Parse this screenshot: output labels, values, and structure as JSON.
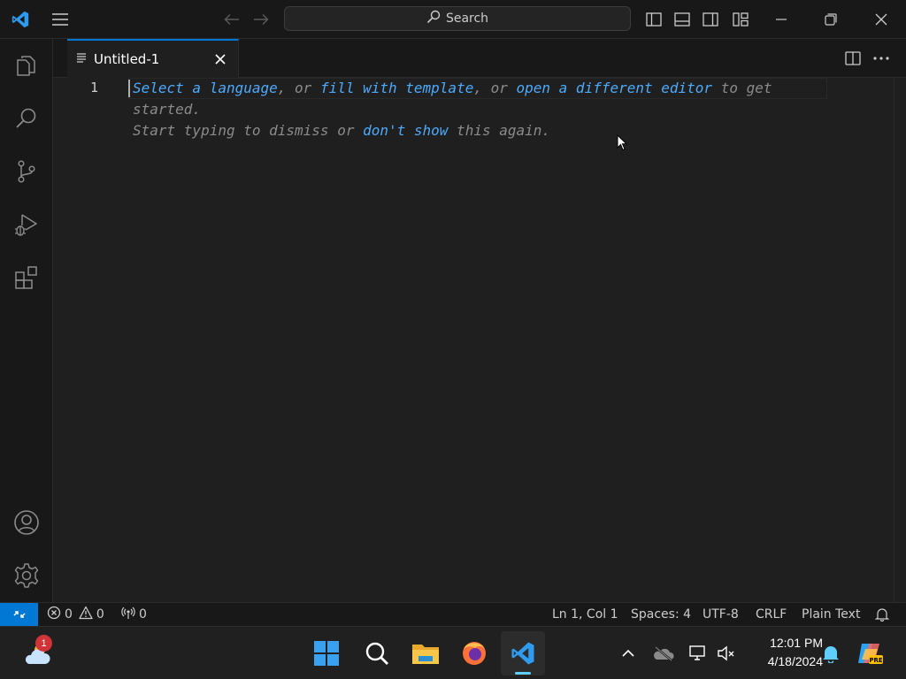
{
  "titlebar": {
    "search_label": "Search",
    "icons": [
      "vscode-logo-icon",
      "menu-icon",
      "back-arrow-icon",
      "forward-arrow-icon",
      "toggle-primary-sidebar-icon",
      "toggle-panel-icon",
      "toggle-secondary-sidebar-icon",
      "customize-layout-icon",
      "minimize-icon",
      "restore-icon",
      "close-icon"
    ]
  },
  "activitybar": {
    "items": [
      "explorer-icon",
      "search-icon",
      "source-control-icon",
      "run-debug-icon",
      "extensions-icon"
    ],
    "bottom": [
      "accounts-icon",
      "settings-gear-icon"
    ]
  },
  "tabs": [
    {
      "label": "Untitled-1",
      "active": true
    }
  ],
  "editor": {
    "line_number": "1",
    "hint": {
      "p1": "Select a language",
      "p2": ", or ",
      "p3": "fill with template",
      "p4": ", or ",
      "p5": "open a different editor",
      "p6": " to get started.",
      "p7": "Start typing to dismiss or ",
      "p8": "don't show",
      "p9": " this again."
    }
  },
  "statusbar": {
    "errors": "0",
    "warnings": "0",
    "ports": "0",
    "position": "Ln 1, Col 1",
    "spaces": "Spaces: 4",
    "encoding": "UTF-8",
    "eol": "CRLF",
    "language": "Plain Text"
  },
  "taskbar": {
    "weather_badge": "1",
    "time": "12:01 PM",
    "date": "4/18/2024",
    "apps": [
      "weather-icon",
      "windows-start-icon",
      "search-icon",
      "file-explorer-icon",
      "firefox-icon",
      "vscode-icon"
    ],
    "tray": [
      "show-hidden-icons-chevron",
      "onedrive-icon",
      "network-icon",
      "volume-muted-icon",
      "notifications-bell-icon",
      "copilot-icon"
    ]
  },
  "colors": {
    "accent": "#0078d4",
    "link": "#4daafc",
    "editor_bg": "#1f1f1f",
    "chrome_bg": "#181818"
  }
}
